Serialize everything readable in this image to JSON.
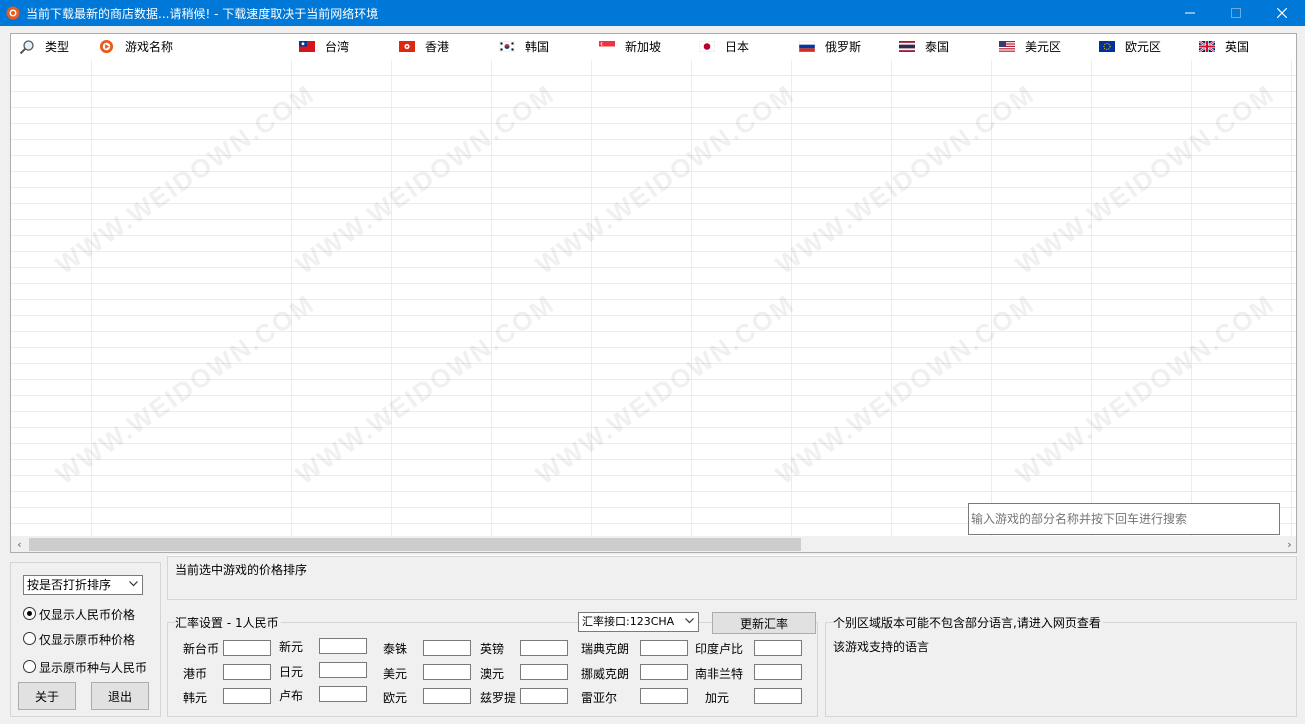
{
  "window": {
    "title": "当前下载最新的商店数据...请稍候! - 下载速度取决于当前网络环境",
    "colors": {
      "titlebar": "#0078d7",
      "app_icon": "#e85c20"
    }
  },
  "grid": {
    "columns": [
      {
        "label": "类型",
        "icon": "search-icon"
      },
      {
        "label": "游戏名称",
        "icon": "game-logo-icon"
      },
      {
        "label": "台湾",
        "icon": "flag-taiwan-icon"
      },
      {
        "label": "香港",
        "icon": "flag-hongkong-icon"
      },
      {
        "label": "韩国",
        "icon": "flag-korea-icon"
      },
      {
        "label": "新加坡",
        "icon": "flag-singapore-icon"
      },
      {
        "label": "日本",
        "icon": "flag-japan-icon"
      },
      {
        "label": "俄罗斯",
        "icon": "flag-russia-icon"
      },
      {
        "label": "泰国",
        "icon": "flag-thailand-icon"
      },
      {
        "label": "美元区",
        "icon": "flag-usa-icon"
      },
      {
        "label": "欧元区",
        "icon": "flag-eu-icon"
      },
      {
        "label": "英国",
        "icon": "flag-uk-icon"
      }
    ],
    "search_placeholder": "输入游戏的部分名称并按下回车进行搜索",
    "watermark": "WWW.WEIDOWN.COM"
  },
  "controls": {
    "sort_select": "按是否打折排序",
    "radios": [
      {
        "label": "仅显示人民币价格",
        "checked": true
      },
      {
        "label": "仅显示原币种价格",
        "checked": false
      },
      {
        "label": "显示原币种与人民币",
        "checked": false
      }
    ],
    "about_button": "关于",
    "exit_button": "退出"
  },
  "price_panel": {
    "title": "当前选中游戏的价格排序"
  },
  "rates": {
    "title": "汇率设置 - 1人民币",
    "api_select": "汇率接口:123CHA",
    "update_button": "更新汇率",
    "currencies": [
      [
        "新台币",
        "新元",
        "泰铢",
        "英镑",
        "瑞典克朗",
        "印度卢比"
      ],
      [
        "港币",
        "日元",
        "美元",
        "澳元",
        "挪威克朗",
        "南非兰特"
      ],
      [
        "韩元",
        "卢布",
        "欧元",
        "兹罗提",
        "雷亚尔",
        "加元"
      ]
    ]
  },
  "language_panel": {
    "note": "个别区域版本可能不包含部分语言,请进入网页查看",
    "title": "该游戏支持的语言"
  }
}
